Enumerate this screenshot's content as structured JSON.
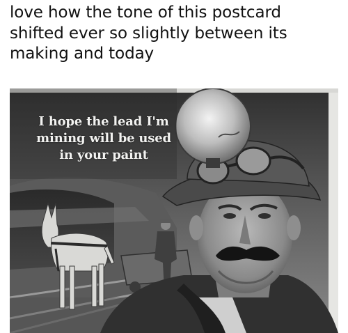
{
  "post": {
    "caption_lines": [
      "love how the tone of this postcard",
      "shifted ever so slightly between its",
      "making and today"
    ]
  },
  "postcard": {
    "text_lines": [
      "I hope the lead I'm",
      "mining will be used",
      "in your paint"
    ]
  },
  "colors": {
    "tone": "#6b6b6b",
    "text": "#f2f2f0"
  }
}
